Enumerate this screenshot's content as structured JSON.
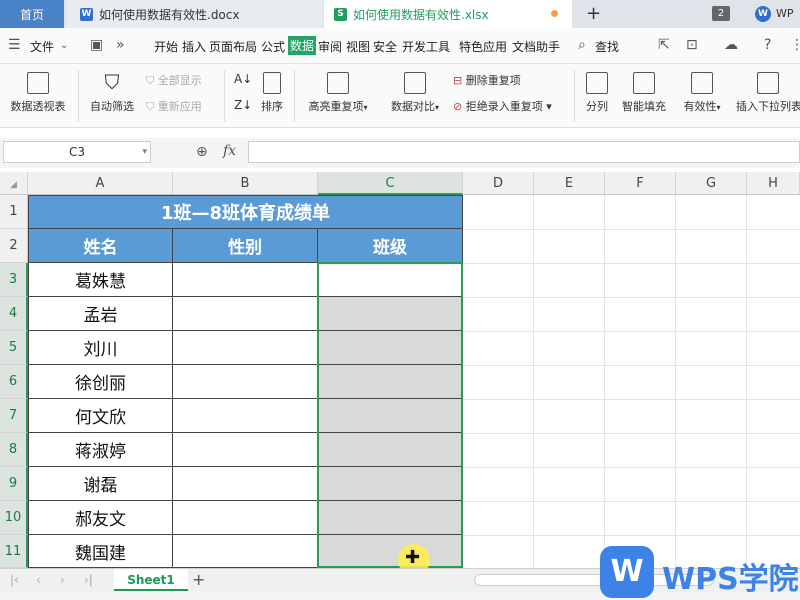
{
  "tabs": {
    "home": "首页",
    "doc1": "如何使用数据有效性.docx",
    "doc2": "如何使用数据有效性.xlsx",
    "new_tab": "+",
    "window_count": "2",
    "brand_short": "WP"
  },
  "menu": {
    "file": "文件",
    "items": [
      "开始",
      "插入",
      "页面布局",
      "公式",
      "数据",
      "审阅",
      "视图",
      "安全",
      "开发工具",
      "特色应用",
      "文档助手"
    ],
    "active": "数据",
    "search": "查找"
  },
  "ribbon": {
    "pivot_table": "数据透视表",
    "auto_filter": "自动筛选",
    "show_all": "全部显示",
    "reapply": "重新应用",
    "sort": "排序",
    "highlight_dup": "高亮重复项",
    "data_compare": "数据对比",
    "remove_dup": "删除重复项",
    "reject_dup": "拒绝录入重复项",
    "split_column": "分列",
    "smart_fill": "智能填充",
    "validity": "有效性",
    "insert_dropdown": "插入下拉列表"
  },
  "formula_bar": {
    "name_box": "C3",
    "fx": "fx",
    "formula": ""
  },
  "columns": [
    "A",
    "B",
    "C",
    "D",
    "E",
    "F",
    "G",
    "H"
  ],
  "rows": [
    "1",
    "2",
    "3",
    "4",
    "5",
    "6",
    "7",
    "8",
    "9",
    "10",
    "11"
  ],
  "sheet": {
    "title": "1班—8班体育成绩单",
    "headers": [
      "姓名",
      "性别",
      "班级"
    ],
    "names": [
      "葛姝慧",
      "孟岩",
      "刘川",
      "徐创丽",
      "何文欣",
      "蒋淑婷",
      "谢磊",
      "郝友文",
      "魏国建"
    ]
  },
  "sheet_tabs": {
    "active": "Sheet1",
    "add": "+"
  },
  "watermark": {
    "logo": "W",
    "text": "WPS学院"
  },
  "colors": {
    "header_fill": "#5b9bd5",
    "selection": "#2c9b52",
    "range_fill": "#d9d9d9",
    "active_tab": "#4a82c8"
  }
}
